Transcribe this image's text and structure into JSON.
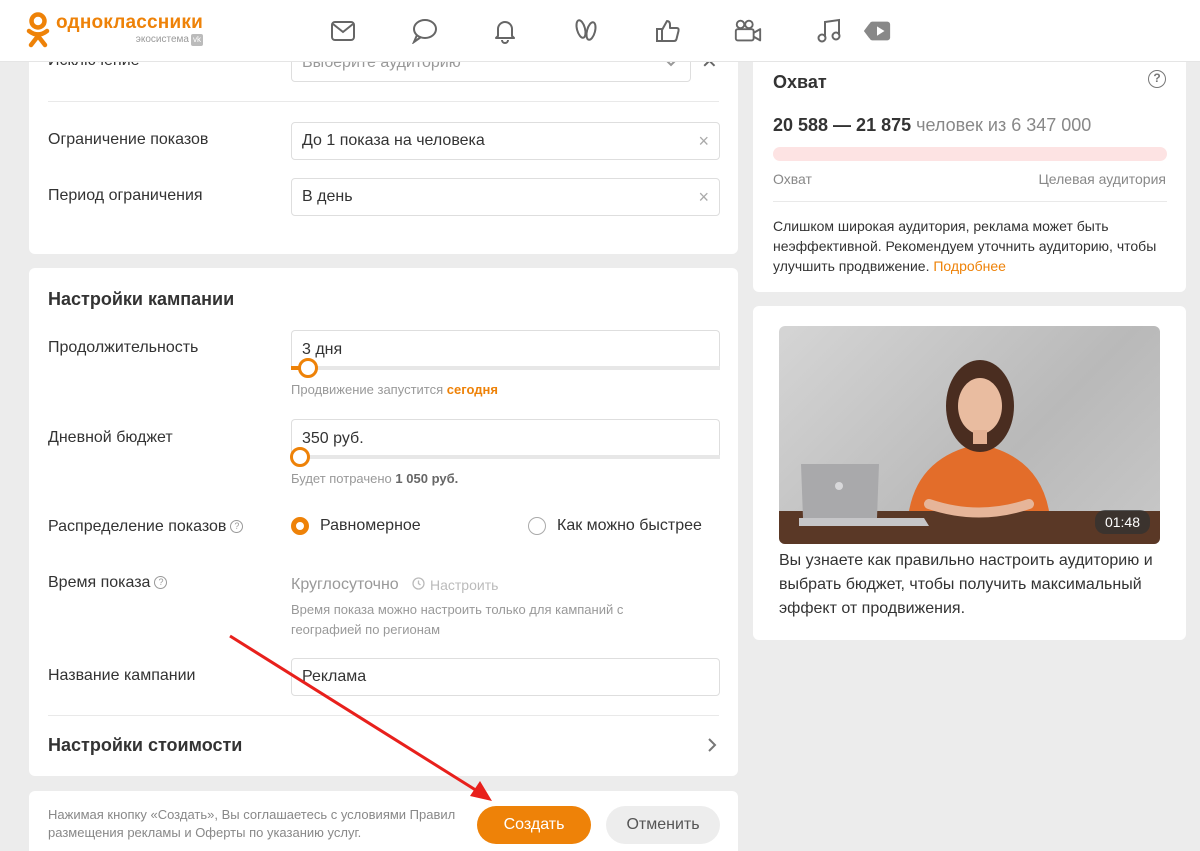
{
  "brand": {
    "name": "одноклассники",
    "sub": "экосистема",
    "sub_badge": "vk",
    "color": "#ee8208"
  },
  "nav_icons": [
    "mail-icon",
    "chat-icon",
    "bell-icon",
    "guests-icon",
    "like-icon",
    "video-camera-icon",
    "music-icon",
    "play-icon"
  ],
  "form_top": {
    "exclusion": {
      "label": "Исключение",
      "placeholder": "Выберите аудиторию"
    },
    "impression_limit": {
      "label": "Ограничение показов",
      "value": "До 1 показа на человека"
    },
    "limit_period": {
      "label": "Период ограничения",
      "value": "В день"
    }
  },
  "campaign": {
    "title": "Настройки кампании",
    "duration": {
      "label": "Продолжительность",
      "value": "3 дня",
      "hint_prefix": "Продвижение запустится",
      "hint_value": "сегодня",
      "level": 0.04
    },
    "daily_budget": {
      "label": "Дневной бюджет",
      "value": "350 руб.",
      "hint_prefix": "Будет потрачено",
      "hint_value": "1 050 руб.",
      "level": 0.02
    },
    "distribution": {
      "label": "Распределение показов",
      "help": "?",
      "option_even": "Равномерное",
      "option_fast": "Как можно быстрее",
      "selected": "Равномерное"
    },
    "schedule": {
      "label": "Время показа",
      "help": "?",
      "value": "Круглосуточно",
      "configure": "Настроить",
      "hint": "Время показа можно настроить только для кампаний с географией по регионам"
    },
    "name": {
      "label": "Название кампании",
      "value": "Реклама"
    },
    "cost_settings": {
      "title": "Настройки стоимости"
    }
  },
  "footer": {
    "terms": "Нажимая кнопку «Создать», Вы соглашаетесь с условиями Правил размещения рекламы и Оферты по указанию услуг.",
    "create": "Создать",
    "cancel": "Отменить"
  },
  "reach": {
    "title": "Охват",
    "help": "?",
    "range": "20 588 — 21 875",
    "suffix": "человек из 6 347 000",
    "left_label": "Охват",
    "right_label": "Целевая аудитория",
    "warning": "Слишком широкая аудитория, реклама может быть неэффективной. Рекомендуем уточнить аудиторию, чтобы улучшить продвижение.",
    "more_link": "Подробнее"
  },
  "video": {
    "duration": "01:48",
    "description": "Вы узнаете как правильно настроить аудиторию и выбрать бюджет, чтобы получить максимальный эффект от продвижения."
  },
  "annotation": {
    "arrow_color": "#e8201c"
  }
}
